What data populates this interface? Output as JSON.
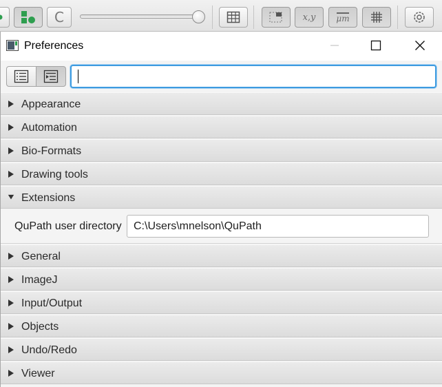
{
  "toolbar": {
    "icons": [
      "record-icon",
      "tree-structure-icon",
      "brush-c-icon",
      "zoom-slider",
      "table-icon",
      "region-icon",
      "xy-coordinates-icon",
      "scalebar-um-icon",
      "grid-icon",
      "settings-gear-icon"
    ],
    "brush_letter": "C",
    "xy_label": "x,y",
    "um_label": "μm"
  },
  "window": {
    "title": "Preferences"
  },
  "filter": {
    "value": "",
    "placeholder": ""
  },
  "categories_before": [
    {
      "label": "Appearance",
      "expanded": false
    },
    {
      "label": "Automation",
      "expanded": false
    },
    {
      "label": "Bio-Formats",
      "expanded": false
    },
    {
      "label": "Drawing tools",
      "expanded": false
    },
    {
      "label": "Extensions",
      "expanded": true
    }
  ],
  "extensions": {
    "property_label": "QuPath user directory",
    "property_value": "C:\\Users\\mnelson\\QuPath"
  },
  "categories_after": [
    {
      "label": "General",
      "expanded": false
    },
    {
      "label": "ImageJ",
      "expanded": false
    },
    {
      "label": "Input/Output",
      "expanded": false
    },
    {
      "label": "Objects",
      "expanded": false
    },
    {
      "label": "Undo/Redo",
      "expanded": false
    },
    {
      "label": "Viewer",
      "expanded": false
    }
  ],
  "colors": {
    "accent": "#3d9be0",
    "brand_green": "#2e9e4f"
  }
}
